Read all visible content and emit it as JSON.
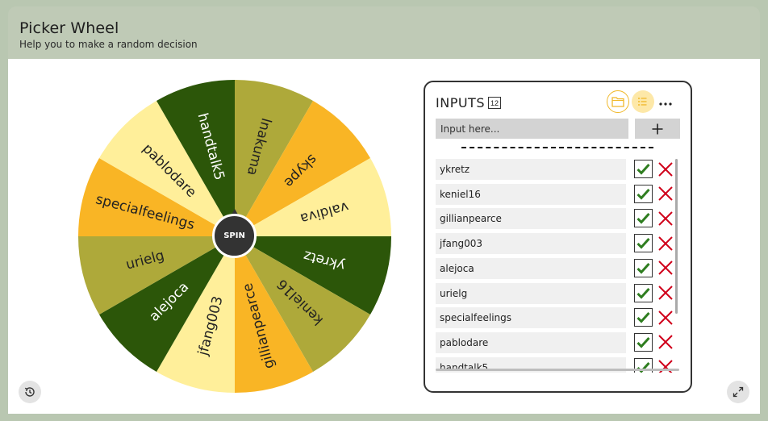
{
  "app": {
    "title": "Picker Wheel",
    "subtitle": "Help you to make a random decision"
  },
  "wheel": {
    "spin_label": "SPIN",
    "slices": [
      {
        "label": "lnakuma",
        "color": "#aea93a",
        "text_color": "#222222"
      },
      {
        "label": "skype",
        "color": "#f9b525",
        "text_color": "#222222"
      },
      {
        "label": "valdiva",
        "color": "#ffef9a",
        "text_color": "#222222"
      },
      {
        "label": "ykretz",
        "color": "#2c5609",
        "text_color": "#ffffff"
      },
      {
        "label": "keniel16",
        "color": "#aea93a",
        "text_color": "#222222"
      },
      {
        "label": "gillianpearce",
        "color": "#f9b525",
        "text_color": "#222222"
      },
      {
        "label": "jfang003",
        "color": "#ffef9a",
        "text_color": "#222222"
      },
      {
        "label": "alejoca",
        "color": "#2c5609",
        "text_color": "#ffffff"
      },
      {
        "label": "urielg",
        "color": "#aea93a",
        "text_color": "#222222"
      },
      {
        "label": "specialfeelings",
        "color": "#f9b525",
        "text_color": "#222222"
      },
      {
        "label": "pablodare",
        "color": "#ffef9a",
        "text_color": "#222222"
      },
      {
        "label": "handtalk5",
        "color": "#2c5609",
        "text_color": "#ffffff"
      }
    ]
  },
  "panel": {
    "title": "INPUTS",
    "count": "12",
    "input_placeholder": "Input here...",
    "add_icon": "plus-icon",
    "items": [
      "ykretz",
      "keniel16",
      "gillianpearce",
      "jfang003",
      "alejoca",
      "urielg",
      "specialfeelings",
      "pablodare",
      "handtalk5"
    ]
  },
  "colors": {
    "accent": "#f0b82a",
    "check": "#2e7d1f",
    "delete": "#d0021b"
  }
}
